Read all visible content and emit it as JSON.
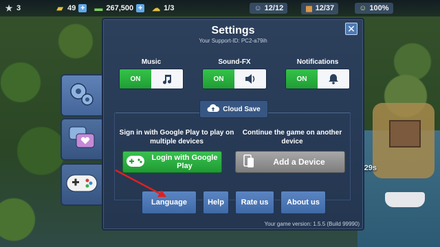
{
  "topbar": {
    "level": "3",
    "gold": "49",
    "cash": "267,500",
    "energy": "1/3",
    "population": "12/12",
    "storage": "12/37",
    "happiness": "100%"
  },
  "map": {
    "timer": "29s"
  },
  "tabs": [
    {
      "name": "general",
      "icon": "gears-icon"
    },
    {
      "name": "social",
      "icon": "chat-hearts-icon"
    },
    {
      "name": "game",
      "icon": "gamepad-icon"
    }
  ],
  "dialog": {
    "title": "Settings",
    "support_id": "Your Support-ID: PC2-a79ih",
    "close_label": "✕",
    "toggles": {
      "music": {
        "label": "Music",
        "state": "ON",
        "icon": "music-note-icon"
      },
      "sfx": {
        "label": "Sound-FX",
        "state": "ON",
        "icon": "speaker-icon"
      },
      "notifications": {
        "label": "Notifications",
        "state": "ON",
        "icon": "bell-icon"
      }
    },
    "cloud": {
      "tab_label": "Cloud Save",
      "left_desc": "Sign in with Google Play to play on multiple devices",
      "right_desc": "Continue the game on another device",
      "google_label": "Login with Google Play",
      "device_label": "Add a Device"
    },
    "buttons": {
      "language": "Language",
      "help": "Help",
      "rate": "Rate us",
      "about": "About us"
    },
    "version": "Your game version: 1.5.5 (Build 99990)"
  },
  "colors": {
    "dialog_bg": "#2c405c",
    "toggle_on": "#35c24a",
    "button_blue": "#5b85c2",
    "annotation_arrow": "#e02020"
  }
}
